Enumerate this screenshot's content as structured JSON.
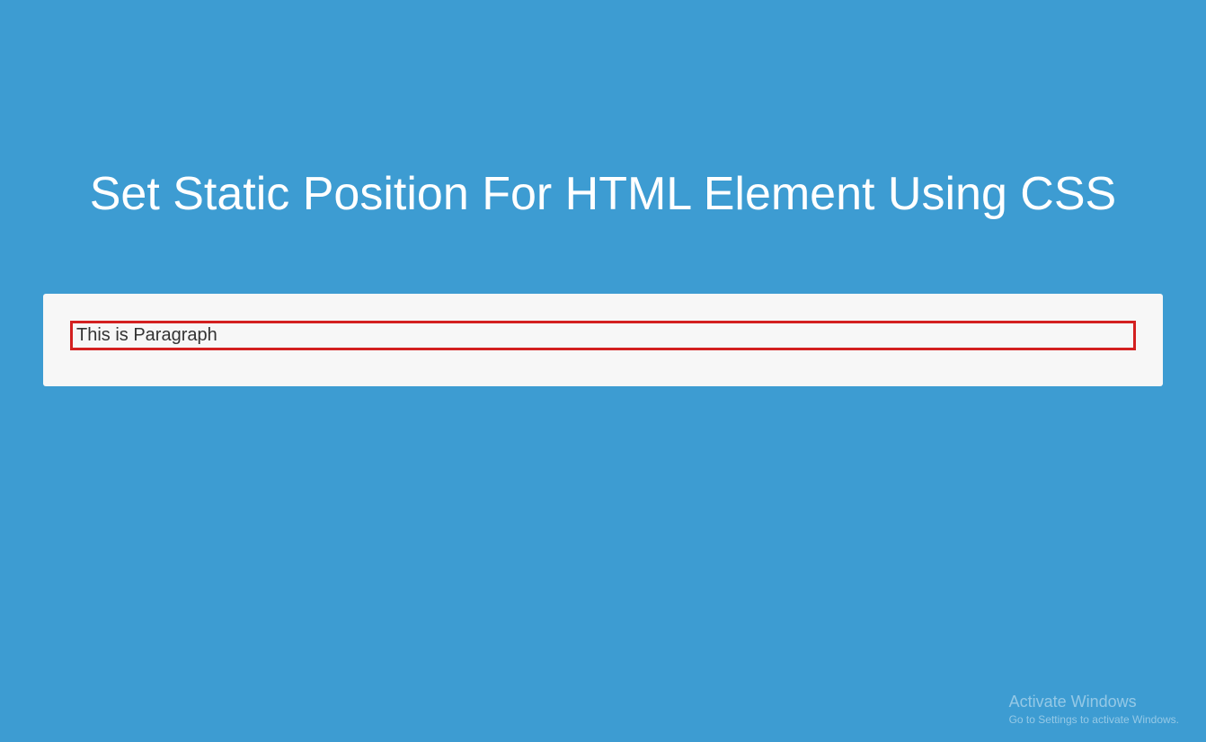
{
  "heading": "Set Static Position For HTML Element Using CSS",
  "paragraph": "This is Paragraph",
  "watermark": {
    "title": "Activate Windows",
    "subtitle": "Go to Settings to activate Windows."
  }
}
